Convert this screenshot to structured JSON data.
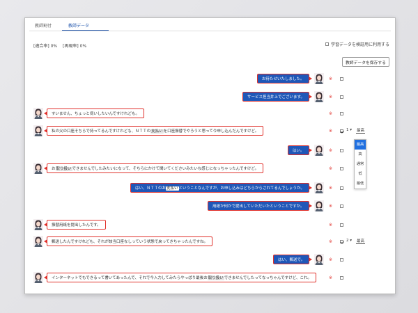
{
  "tabs": [
    {
      "label": "教師割付"
    },
    {
      "label": "教師データ"
    }
  ],
  "rates": {
    "match": "[適合率] 0%",
    "recall": "[再現率] 0%"
  },
  "verify_label": "学習データを検証用に利用する",
  "save_button": "教師データを保存する",
  "row_mark": "※",
  "messages": [
    {
      "side": "right",
      "parts": [
        "お待たせいたしました。"
      ],
      "checked": false
    },
    {
      "side": "right",
      "parts": [
        "サービス担当井上でございます。"
      ],
      "checked": false
    },
    {
      "side": "left",
      "parts": [
        "すいません、ちょっと伺いしたいんですけれども。"
      ],
      "checked": false
    },
    {
      "side": "left",
      "parts": [
        "私の父の口座そちらで持ってるんですけれども、ＮＴＴの",
        "支払い",
        "を口座振替でやろうと思って今申し込んだんですけど。"
      ],
      "checked": true,
      "num": "1",
      "grade": "最高"
    },
    {
      "side": "right",
      "parts": [
        "はい。"
      ],
      "checked": false
    },
    {
      "side": "left",
      "parts": [
        "お",
        "取り扱い",
        "できませんでしたみたいになって、そちらにかけて聞いてくださいみたいな感じになっちゃったんですけど。"
      ],
      "checked": false
    },
    {
      "side": "right",
      "parts": [
        "はい、ＮＴＴのお",
        "支払い",
        "ということなんですが、お申し込みはどちらからされてるんでしょうか。"
      ],
      "checked": false
    },
    {
      "side": "right",
      "parts": [
        "用紙か何かで提出していただいたということですか。"
      ],
      "checked": false
    },
    {
      "side": "left",
      "parts": [
        "振替用紙を提出したんです。"
      ],
      "checked": false
    },
    {
      "side": "left",
      "parts": [
        "郵送したんですけれども、それが該当口座なしっていう状態で戻ってきちゃったんですね。"
      ],
      "checked": true,
      "num": "2",
      "grade": "最高"
    },
    {
      "side": "right",
      "parts": [
        "はい、郵送で。"
      ],
      "checked": false
    },
    {
      "side": "left",
      "parts": [
        "インターネットでもできるって書いてあったんで、それで今入力してみたらやっぱり最後お",
        "取り扱い",
        "できませんでしたってなっちゃんですけど、これ。"
      ],
      "checked": false
    }
  ],
  "grade_options": [
    "最高",
    "高",
    "通常",
    "低",
    "最低"
  ],
  "grade_selected": "最高",
  "colors": {
    "agent_bubble": "#1f57b8",
    "bubble_border": "#e0302a",
    "accent": "#2a5db0"
  }
}
